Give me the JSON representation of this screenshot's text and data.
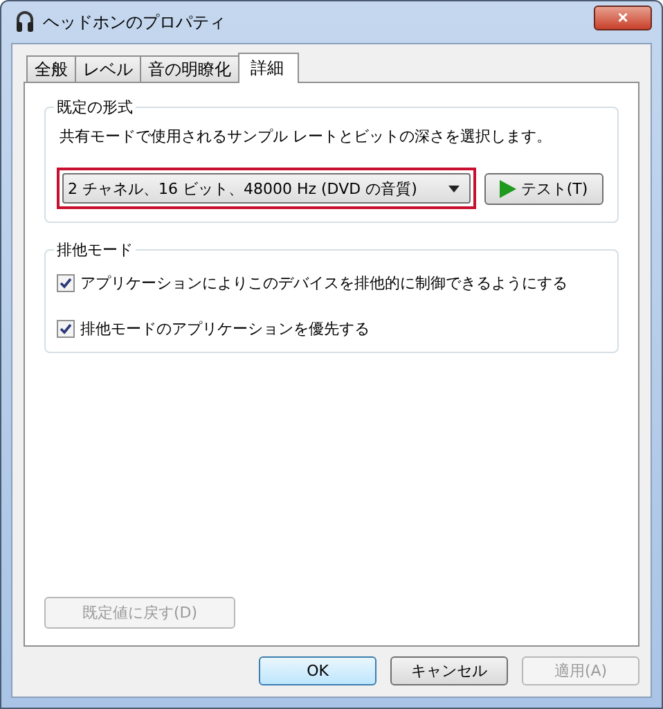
{
  "window": {
    "title": "ヘッドホンのプロパティ",
    "close": "×"
  },
  "tabs": [
    {
      "label": "全般",
      "selected": false
    },
    {
      "label": "レベル",
      "selected": false
    },
    {
      "label": "音の明瞭化",
      "selected": false
    },
    {
      "label": "詳細",
      "selected": true
    }
  ],
  "default_format": {
    "title": "既定の形式",
    "description": "共有モードで使用されるサンプル レートとビットの深さを選択します。",
    "format": "2 チャネル、16 ビット、48000 Hz (DVD の音質)",
    "highlighted": true,
    "test_button": {
      "label": "テスト(T)",
      "disabled": false
    }
  },
  "exclusive_mode": {
    "title": "排他モード",
    "options": [
      {
        "label": "アプリケーションによりこのデバイスを排他的に制御できるようにする",
        "checked": true
      },
      {
        "label": "排他モードのアプリケーションを優先する",
        "checked": true
      }
    ]
  },
  "restore_button": {
    "label": "既定値に戻す(D)",
    "disabled": true
  },
  "buttons": [
    {
      "label": "OK",
      "disabled": false,
      "default": true
    },
    {
      "label": "キャンセル",
      "disabled": false,
      "default": false
    },
    {
      "label": "適用(A)",
      "disabled": true,
      "default": false
    }
  ]
}
